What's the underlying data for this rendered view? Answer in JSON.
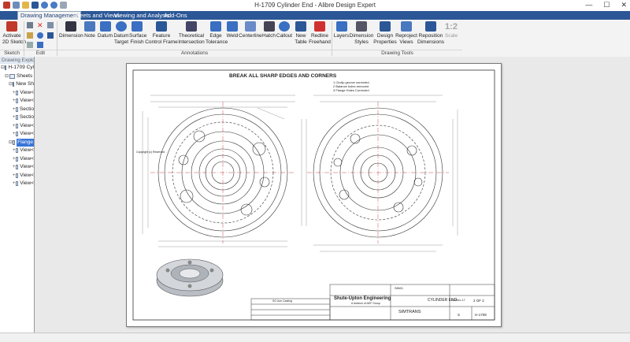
{
  "window": {
    "title": "H-1709 Cylinder End - Alibre Design Expert",
    "controls": [
      "—",
      "☐",
      "✕"
    ]
  },
  "tabs": [
    {
      "label": "Drawing Management",
      "active": true
    },
    {
      "label": "Sheets and Views",
      "active": false
    },
    {
      "label": "Viewing and Analysis",
      "active": false
    },
    {
      "label": "Add-Ons",
      "active": false
    }
  ],
  "ribbon": {
    "activate": "Activate\n2D Sketch",
    "dimension": "Dimension",
    "note": "Note",
    "datum": "Datum",
    "datum_target": "Datum\nTarget",
    "surface_finish": "Surface\nFinish",
    "feature_control_frame": "Feature\nControl Frame",
    "theoretical_intersection": "Theoretical\nIntersection",
    "edge_tolerance": "Edge\nTolerance",
    "weld": "Weld",
    "centerline": "Centerline",
    "hatch": "Hatch",
    "callout": "Callout",
    "new_table": "New\nTable",
    "redline_freehand": "Redline\nFreehand",
    "layers": "Layers",
    "dimension_styles": "Dimension\nStyles",
    "design_properties": "Design\nProperties",
    "reproject_views": "Reproject\nViews",
    "reposition_dimensions": "Reposition\nDimensions",
    "scale": "Scale",
    "scale_value": "1:2",
    "groups": {
      "sketch": "Sketch",
      "edit": "Edit",
      "annotations": "Annotations",
      "drawing_tools": "Drawing Tools"
    }
  },
  "explorer": {
    "header": "Drawing Explorer",
    "items": [
      {
        "label": "H-1709 Cyl",
        "level": 0,
        "pm": "⊟"
      },
      {
        "label": "Sheets",
        "level": 1,
        "pm": "⊟"
      },
      {
        "label": "New Sh",
        "level": 2,
        "pm": "⊟"
      },
      {
        "label": "View<",
        "level": 3,
        "pm": "+"
      },
      {
        "label": "View<",
        "level": 3,
        "pm": "+"
      },
      {
        "label": "Sectio",
        "level": 3,
        "pm": "+"
      },
      {
        "label": "Sectio",
        "level": 3,
        "pm": "+"
      },
      {
        "label": "View<",
        "level": 3,
        "pm": "+"
      },
      {
        "label": "View<",
        "level": 3,
        "pm": "+"
      },
      {
        "label": "Flange",
        "level": 2,
        "pm": "⊟",
        "selected": true
      },
      {
        "label": "View<",
        "level": 3,
        "pm": "+"
      },
      {
        "label": "View<",
        "level": 3,
        "pm": "+"
      },
      {
        "label": "View<",
        "level": 3,
        "pm": "+"
      },
      {
        "label": "View<",
        "level": 3,
        "pm": "+"
      },
      {
        "label": "View<",
        "level": 3,
        "pm": "+"
      }
    ]
  },
  "drawing": {
    "title_note": "BREAK ALL SHARP EDGES AND CORNERS",
    "revision_notes": [
      "1 Circlip groove corrected",
      "2 Balance holes removed",
      "3 Flange Holes Corrected"
    ],
    "copyright": "Copyright (c) Reserved",
    "company": "Shute-Upton Engineering",
    "company_sub": "A division of AEF Group",
    "part_title": "CYLINDER END",
    "customer": "SIMTRANS",
    "material": "SG Iron Casting",
    "drawing_number": "H-1709",
    "sheet": "2 OF 2",
    "date": "01-Dec-17",
    "size_label": "S",
    "job_number": "S8601"
  }
}
